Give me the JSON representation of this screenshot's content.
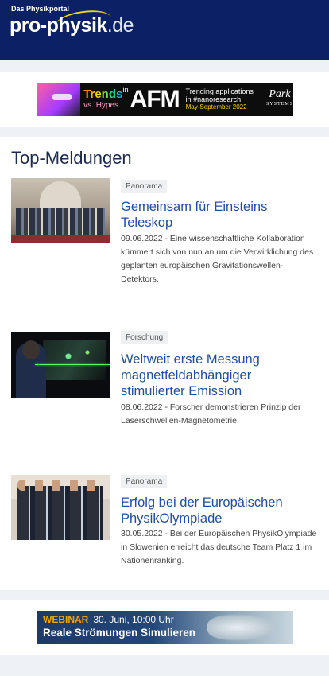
{
  "header": {
    "tagline": "Das Physikportal",
    "logo_main": "pro-physik",
    "logo_tld": ".de",
    "brand_color": "#0c2165"
  },
  "ad_top": {
    "word_trends": "Trends",
    "word_in": "in",
    "word_vs_hypes": "vs. Hypes",
    "word_afm": "AFM",
    "text_line1": "Trending applications",
    "text_line2": "in #nanoresearch",
    "text_dates": "May-September 2022",
    "sponsor": "Park",
    "sponsor_sub": "SYSTEMS"
  },
  "section": {
    "title": "Top-Meldungen"
  },
  "articles": [
    {
      "tag": "Panorama",
      "title": "Gemeinsam für Einsteins Teleskop",
      "text": "09.06.2022 - Eine wissenschaftliche Kollaboration kümmert sich von nun an um die Verwirklichung des geplanten europäischen Gravitationswellen-Detektors."
    },
    {
      "tag": "Forschung",
      "title": "Weltweit erste Messung magnetfeldabhängiger stimulierter Emission",
      "text": "08.06.2022 - Forscher demonstrieren Prinzip der Laserschwellen-Magnetometrie."
    },
    {
      "tag": "Panorama",
      "title": "Erfolg bei der Europäischen PhysikOlympiade",
      "text": "30.05.2022 - Bei der Europäischen PhysikOlympiade in Slowenien erreicht das deutsche Team Platz 1 im Nationenranking."
    }
  ],
  "ad_bottom": {
    "label": "WEBINAR",
    "date": "30. Juni, 10:00 Uhr",
    "title": "Reale Strömungen Simulieren"
  }
}
